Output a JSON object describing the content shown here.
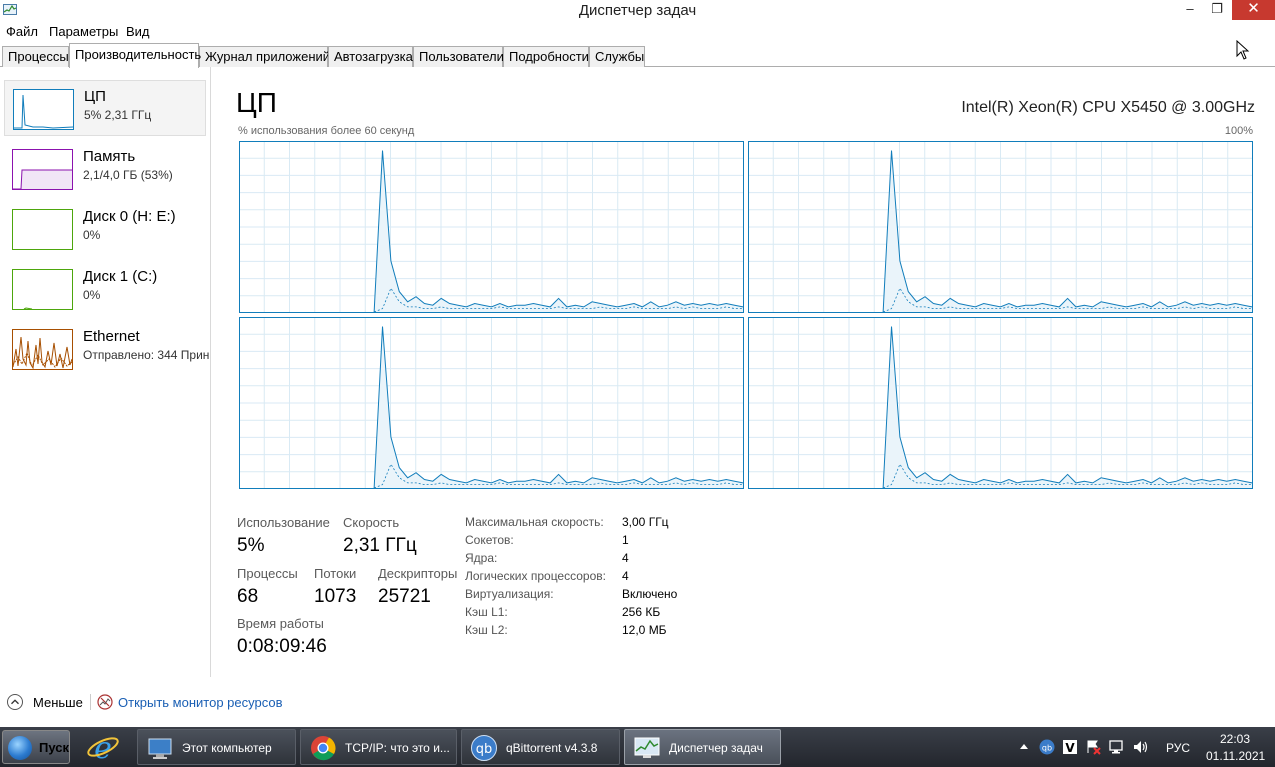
{
  "window": {
    "title": "Диспетчер задач",
    "minimize": "‒",
    "maximize": "❐",
    "close": "✕"
  },
  "menu": [
    "Файл",
    "Параметры",
    "Вид"
  ],
  "tabs": [
    "Процессы",
    "Производительность",
    "Журнал приложений",
    "Автозагрузка",
    "Пользователи",
    "Подробности",
    "Службы"
  ],
  "active_tab": "Производительность",
  "sidebar": {
    "items": [
      {
        "name": "ЦП",
        "sub": "5% 2,31 ГГц",
        "color": "#117dbb"
      },
      {
        "name": "Память",
        "sub": "2,1/4,0 ГБ (53%)",
        "color": "#8b12ae"
      },
      {
        "name": "Диск 0 (H: E:)",
        "sub": "0%",
        "color": "#4da60c"
      },
      {
        "name": "Диск 1 (C:)",
        "sub": "0%",
        "color": "#4da60c"
      },
      {
        "name": "Ethernet",
        "sub": "Отправлено: 344 Прин",
        "color": "#a74f01"
      }
    ]
  },
  "main": {
    "title": "ЦП",
    "model": "Intel(R) Xeon(R) CPU X5450 @ 3.00GHz",
    "axis_label": "% использования более 60 секунд",
    "axis_max": "100%",
    "graph_color": "#117dbb"
  },
  "stats": {
    "usage_label": "Использование",
    "usage_value": "5%",
    "speed_label": "Скорость",
    "speed_value": "2,31 ГГц",
    "processes_label": "Процессы",
    "processes_value": "68",
    "threads_label": "Потоки",
    "threads_value": "1073",
    "handles_label": "Дескрипторы",
    "handles_value": "25721",
    "uptime_label": "Время работы",
    "uptime_value": "0:08:09:46"
  },
  "details": [
    {
      "key": "Максимальная скорость:",
      "value": "3,00 ГГц"
    },
    {
      "key": "Сокетов:",
      "value": "1"
    },
    {
      "key": "Ядра:",
      "value": "4"
    },
    {
      "key": "Логических процессоров:",
      "value": "4"
    },
    {
      "key": "Виртуализация:",
      "value": "Включено"
    },
    {
      "key": "Кэш L1:",
      "value": "256 КБ"
    },
    {
      "key": "Кэш L2:",
      "value": "12,0 МБ"
    }
  ],
  "footer": {
    "fewer": "Меньше",
    "monitor": "Открыть монитор ресурсов"
  },
  "taskbar": {
    "start": "Пуск",
    "buttons": [
      {
        "label": "Этот компьютер",
        "icon": "computer-icon"
      },
      {
        "label": "TCP/IP: что это и...",
        "icon": "chrome-icon"
      },
      {
        "label": "qBittorrent v4.3.8",
        "icon": "qbittorrent-icon"
      },
      {
        "label": "Диспетчер задач",
        "icon": "task-manager-icon"
      }
    ],
    "lang": "РУС",
    "time": "22:03",
    "date": "01.11.2021"
  }
}
